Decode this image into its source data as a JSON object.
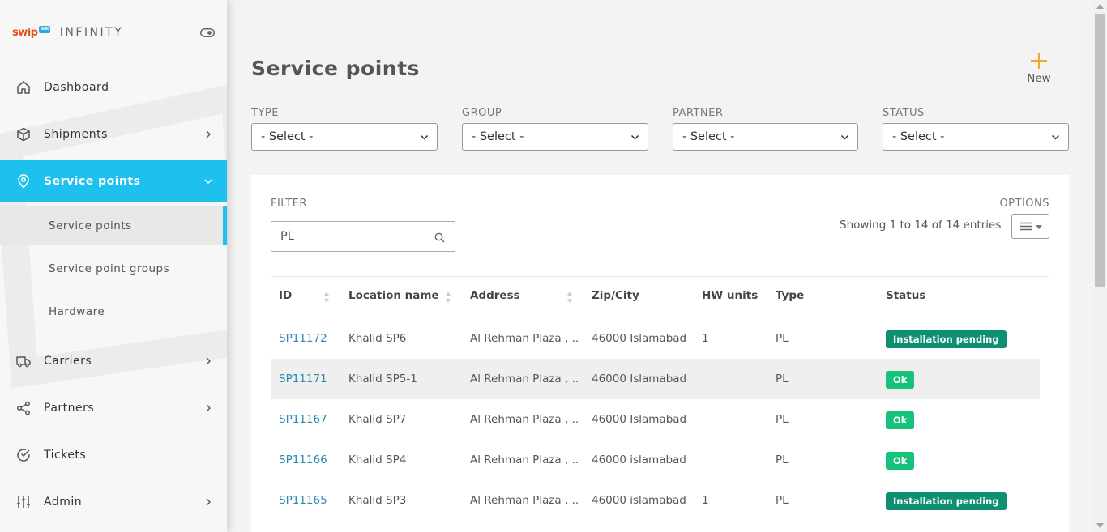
{
  "brand": {
    "logo_text": "swip",
    "logo_box_text": "BOX",
    "product_name": "INFINITY"
  },
  "sidebar": {
    "items": [
      {
        "label": "Dashboard",
        "icon": "home-icon"
      },
      {
        "label": "Shipments",
        "icon": "cube-icon",
        "has_submenu": true
      },
      {
        "label": "Service points",
        "icon": "map-pin-icon",
        "has_submenu": true,
        "expanded": true,
        "active": true
      },
      {
        "label": "Carriers",
        "icon": "truck-icon",
        "has_submenu": true
      },
      {
        "label": "Partners",
        "icon": "share-icon",
        "has_submenu": true
      },
      {
        "label": "Tickets",
        "icon": "check-circle-icon"
      },
      {
        "label": "Admin",
        "icon": "sliders-icon",
        "has_submenu": true
      }
    ],
    "subitems": [
      {
        "label": "Service points",
        "active": true
      },
      {
        "label": "Service point groups"
      },
      {
        "label": "Hardware"
      }
    ]
  },
  "page": {
    "title": "Service points",
    "new_label": "New"
  },
  "filters": [
    {
      "label": "TYPE",
      "value": "- Select -"
    },
    {
      "label": "GROUP",
      "value": "- Select -"
    },
    {
      "label": "PARTNER",
      "value": "- Select -"
    },
    {
      "label": "STATUS",
      "value": "- Select -"
    }
  ],
  "table_panel": {
    "filter_label": "FILTER",
    "search_value": "PL",
    "options_label": "OPTIONS",
    "entries_text": "Showing 1 to 14 of 14 entries"
  },
  "table": {
    "columns": [
      "ID",
      "Location name",
      "Address",
      "Zip/City",
      "HW units",
      "Type",
      "Status"
    ],
    "rows": [
      {
        "id": "SP11172",
        "location": "Khalid SP6",
        "address": "Al Rehman Plaza , ...",
        "zip_city": "46000 Islamabad",
        "hw_units": "1",
        "type": "PL",
        "status": "Installation pending",
        "status_kind": "pending"
      },
      {
        "id": "SP11171",
        "location": "Khalid SP5-1",
        "address": "Al Rehman Plaza , ...",
        "zip_city": "46000 Islamabad",
        "hw_units": "",
        "type": "PL",
        "status": "Ok",
        "status_kind": "ok"
      },
      {
        "id": "SP11167",
        "location": "Khalid SP7",
        "address": "Al Rehman Plaza , ...",
        "zip_city": "46000 Islamabad",
        "hw_units": "",
        "type": "PL",
        "status": "Ok",
        "status_kind": "ok"
      },
      {
        "id": "SP11166",
        "location": "Khalid SP4",
        "address": "Al Rehman Plaza , ...",
        "zip_city": "46000 islamabad",
        "hw_units": "",
        "type": "PL",
        "status": "Ok",
        "status_kind": "ok"
      },
      {
        "id": "SP11165",
        "location": "Khalid SP3",
        "address": "Al Rehman Plaza , ...",
        "zip_city": "46000 islamabad",
        "hw_units": "1",
        "type": "PL",
        "status": "Installation pending",
        "status_kind": "pending"
      }
    ]
  },
  "colors": {
    "accent": "#1ec1ee",
    "link": "#2b8bb0",
    "status_pending": "#0e8f72",
    "status_ok": "#17c37b",
    "new_plus": "#f0a830"
  }
}
